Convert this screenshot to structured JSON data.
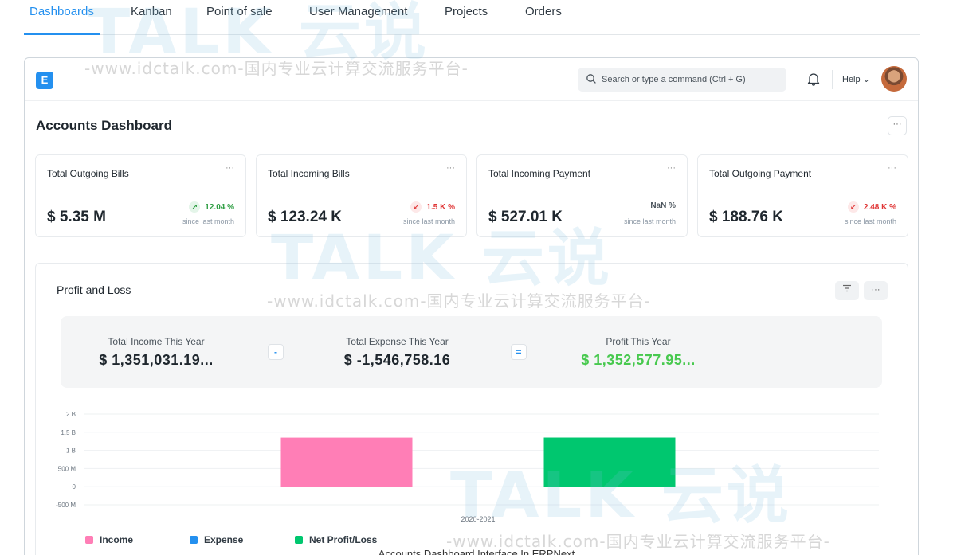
{
  "nav": {
    "tabs": [
      {
        "label": "Dashboards",
        "active": true
      },
      {
        "label": "Kanban"
      },
      {
        "label": "Point of sale"
      },
      {
        "label": "User Management"
      },
      {
        "label": "Projects"
      },
      {
        "label": "Orders"
      }
    ]
  },
  "watermark": {
    "text": "-www.idctalk.com-国内专业云计算交流服务平台-",
    "logo_text": "TALK 云说"
  },
  "appbar": {
    "logo_letter": "E",
    "search_placeholder": "Search or type a command (Ctrl + G)",
    "help_label": "Help ⌄",
    "notification_icon": "bell-icon"
  },
  "page": {
    "title": "Accounts Dashboard",
    "more_label": "···"
  },
  "cards": [
    {
      "title": "Total Outgoing Bills",
      "value": "$ 5.35 M",
      "change": "12.04 %",
      "trend": "up",
      "since": "since last month"
    },
    {
      "title": "Total Incoming Bills",
      "value": "$ 123.24 K",
      "change": "1.5 K %",
      "trend": "down",
      "since": "since last month"
    },
    {
      "title": "Total Incoming Payment",
      "value": "$ 527.01 K",
      "change": "NaN %",
      "trend": "none",
      "since": "since last month"
    },
    {
      "title": "Total Outgoing Payment",
      "value": "$ 188.76 K",
      "change": "2.48 K %",
      "trend": "down",
      "since": "since last month"
    }
  ],
  "profit_loss": {
    "title": "Profit and Loss",
    "summary": [
      {
        "label": "Total Income This Year",
        "value": "$ 1,351,031.19..."
      },
      {
        "label": "Total Expense This Year",
        "value": "$ -1,546,758.16"
      },
      {
        "label": "Profit This Year",
        "value": "$ 1,352,577.95..."
      }
    ],
    "operators": [
      "-",
      "="
    ]
  },
  "colors": {
    "accent": "#2490ef",
    "income": "#ff7eb6",
    "expense": "#2490ef",
    "net": "#00c76f",
    "profit_text": "#48c94f"
  },
  "chart_data": {
    "type": "bar",
    "categories": [
      "2020-2021"
    ],
    "series": [
      {
        "name": "Income",
        "values": [
          1351031.19
        ]
      },
      {
        "name": "Expense",
        "values": [
          -1546.75816
        ]
      },
      {
        "name": "Net Profit/Loss",
        "values": [
          1352577.95
        ]
      }
    ],
    "yticks": [
      "2 B",
      "1.5 B",
      "1 B",
      "500 M",
      "0",
      "-500 M"
    ],
    "ytick_values": [
      2000000000,
      1500000000,
      1000000000,
      500000000,
      0,
      -500000000
    ],
    "ylim": [
      -500000000,
      2000000000
    ],
    "legend_position": "bottom-left"
  },
  "caption": "Accounts Dashboard Interface In ERPNext"
}
